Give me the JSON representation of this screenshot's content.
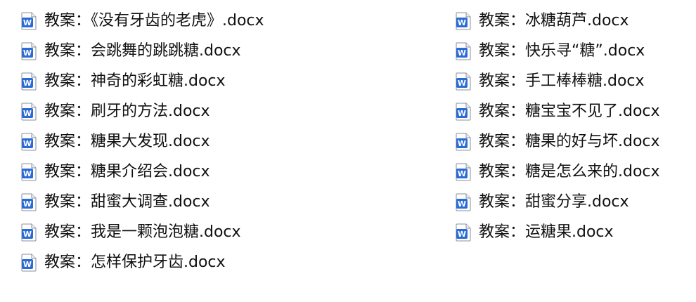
{
  "icon": {
    "name": "word-document-icon",
    "letter": "W",
    "color": "#2B6BD6"
  },
  "files": {
    "left": [
      "教案：《没有牙齿的老虎》.docx",
      "教案：会跳舞的跳跳糖.docx",
      "教案：神奇的彩虹糖.docx",
      "教案：刷牙的方法.docx",
      "教案：糖果大发现.docx",
      "教案：糖果介绍会.docx",
      "教案：甜蜜大调查.docx",
      "教案：我是一颗泡泡糖.docx",
      "教案：怎样保护牙齿.docx"
    ],
    "right": [
      "教案：冰糖葫芦.docx",
      "教案：快乐寻“糖”.docx",
      "教案：手工棒棒糖.docx",
      "教案：糖宝宝不见了.docx",
      "教案：糖果的好与坏.docx",
      "教案：糖是怎么来的.docx",
      "教案：甜蜜分享.docx",
      "教案：运糖果.docx"
    ]
  }
}
